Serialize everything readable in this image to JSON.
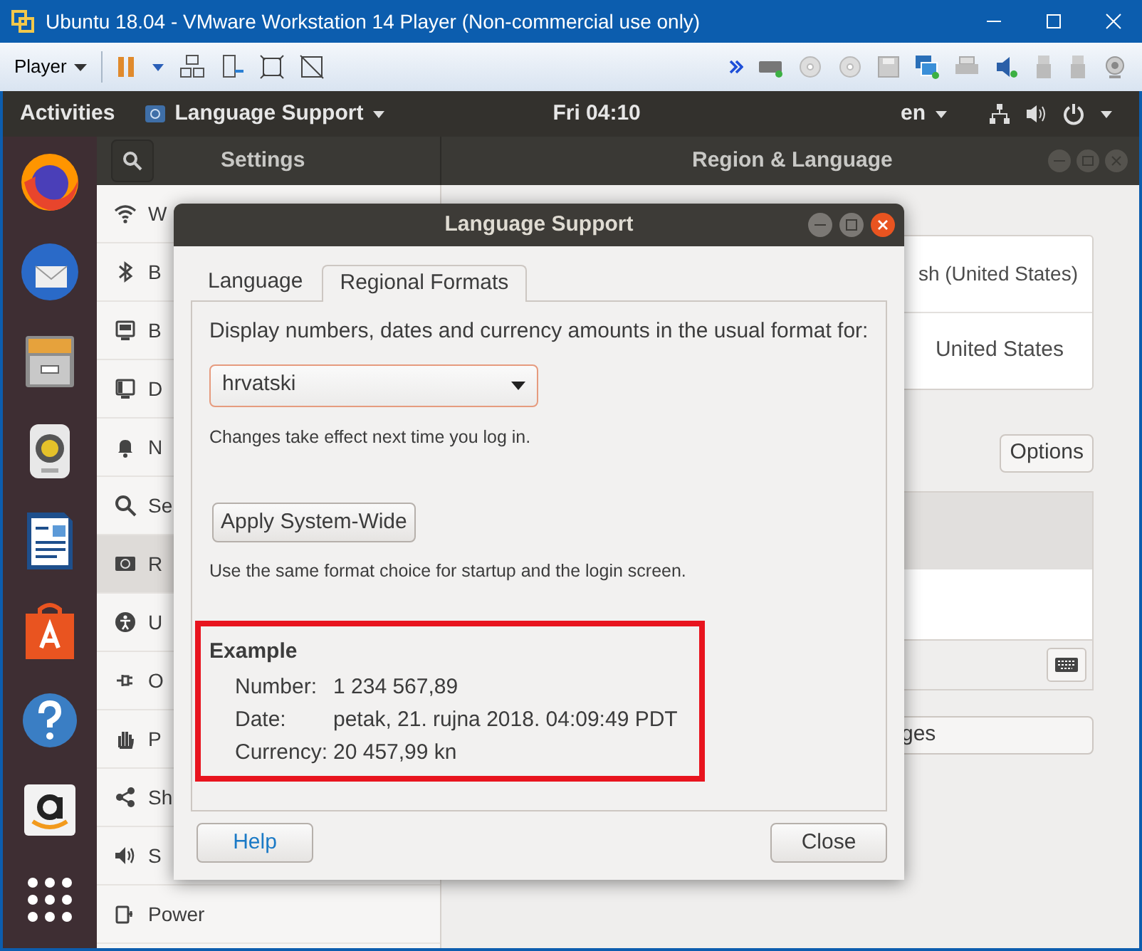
{
  "vm_window": {
    "title": "Ubuntu 18.04 - VMware Workstation 14 Player (Non-commercial use only)",
    "menu": "Player"
  },
  "top_bar": {
    "activities": "Activities",
    "app_menu": "Language Support",
    "clock": "Fri 04:10",
    "input_source": "en"
  },
  "settings": {
    "title": "Settings",
    "panel_title": "Region & Language",
    "sidebar": [
      {
        "label": "W",
        "selected": false
      },
      {
        "label": "B",
        "selected": false
      },
      {
        "label": "B",
        "selected": false
      },
      {
        "label": "D",
        "selected": false
      },
      {
        "label": "N",
        "selected": false
      },
      {
        "label": "Se",
        "selected": false
      },
      {
        "label": "R",
        "selected": true
      },
      {
        "label": "U",
        "selected": false
      },
      {
        "label": "O",
        "selected": false
      },
      {
        "label": "P",
        "selected": false
      },
      {
        "label": "Sh",
        "selected": false
      },
      {
        "label": "S",
        "selected": false
      },
      {
        "label": "Power",
        "selected": false
      }
    ],
    "language_value": "sh (United States)",
    "formats_value": "United States",
    "options_button": "Options",
    "manage_button": "ges"
  },
  "dialog": {
    "title": "Language Support",
    "tabs": [
      {
        "label": "Language",
        "selected": false
      },
      {
        "label": "Regional Formats",
        "selected": true
      }
    ],
    "prompt": "Display numbers, dates and currency amounts in the usual format for:",
    "format": "hrvatski",
    "note": "Changes take effect next time you log in.",
    "apply_button": "Apply System-Wide",
    "apply_note": "Use the same format choice for startup and the login screen.",
    "example": {
      "heading": "Example",
      "rows": [
        {
          "label": "Number:",
          "value": "1 234 567,89"
        },
        {
          "label": "Date:",
          "value": "petak, 21. rujna 2018. 04:09:49 PDT"
        },
        {
          "label": "Currency:",
          "value": "20 457,99 kn"
        }
      ]
    },
    "buttons": [
      {
        "label": "Help",
        "kind": "help"
      },
      {
        "label": "Close",
        "kind": "normal"
      }
    ]
  }
}
